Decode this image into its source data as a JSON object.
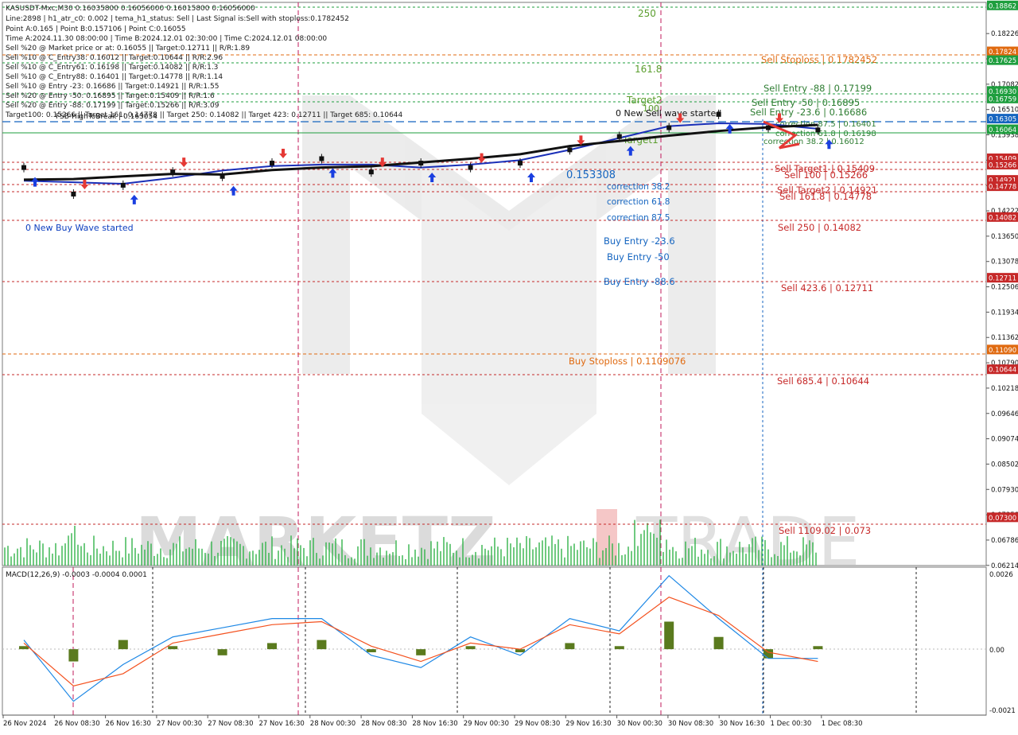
{
  "header": {
    "symbol_line": "KASUSDT-Mxc,M30  0.16035800 0.16056000 0.16015800 0.16056000",
    "info_lines": [
      "Line:2898 | h1_atr_c0: 0.002 | tema_h1_status: Sell | Last Signal is:Sell with stoploss:0.1782452",
      "Point A:0.165 | Point B:0.157106 | Point C:0.16055",
      "Time A:2024.11.30 08:00:00 | Time B:2024.12.01 02:30:00 | Time C:2024.12.01 08:00:00",
      "Sell %20 @ Market price or at: 0.16055 || Target:0.12711 || R/R:1.89",
      "Sell %10 @ C_Entry38: 0.16012 || Target:0.10644 || R/R:2.96",
      "Sell %10 @ C_Entry61: 0.16198 || Target:0.14082 || R/R:1.3",
      "Sell %10 @ C_Entry88: 0.16401 || Target:0.14778 || R/R:1.14",
      "Sell %10 @ Entry -23: 0.16686 || Target:0.14921 || R/R:1.55",
      "Sell %20 @ Entry -50: 0.16895 || Target:0.15409 || R/R:1.6",
      "Sell %20 @ Entry -88: 0.17199 || Target:0.15266 || R/R:3.09",
      "Target100: 0.15266 || Target 161: 0.14778 || Target 250: 0.14082 || Target 423: 0.12711 || Target 685: 0.10644"
    ]
  },
  "watermark": {
    "brand_left": "MARKETZ",
    "brand_right": "TRADE"
  },
  "price_axis": {
    "ticks": [
      "0.18226",
      "0.17654",
      "0.17082",
      "0.16510",
      "0.15938",
      "0.15366",
      "0.14794",
      "0.14222",
      "0.13650",
      "0.13078",
      "0.12506",
      "0.11934",
      "0.11362",
      "0.10790",
      "0.10218",
      "0.09646",
      "0.09074",
      "0.08502",
      "0.07930",
      "0.07358",
      "0.06786",
      "0.06214"
    ]
  },
  "price_tags": [
    {
      "text": "0.18862",
      "color": "#1e9e3e"
    },
    {
      "text": "0.17824",
      "color": "#e06a10"
    },
    {
      "text": "0.17625",
      "color": "#1e9e3e"
    },
    {
      "text": "0.16930",
      "color": "#1e9e3e"
    },
    {
      "text": "0.16759",
      "color": "#1e9e3e"
    },
    {
      "text": "0.16305",
      "color": "#1565c0"
    },
    {
      "text": "0.16064",
      "color": "#1e9e3e"
    },
    {
      "text": "0.15409",
      "color": "#c62828"
    },
    {
      "text": "0.15266",
      "color": "#c62828"
    },
    {
      "text": "0.14921",
      "color": "#c62828"
    },
    {
      "text": "0.14778",
      "color": "#c62828"
    },
    {
      "text": "0.14082",
      "color": "#c62828"
    },
    {
      "text": "0.12711",
      "color": "#c62828"
    },
    {
      "text": "0.11090",
      "color": "#e06a10"
    },
    {
      "text": "0.10644",
      "color": "#c62828"
    },
    {
      "text": "0.07300",
      "color": "#c62828"
    }
  ],
  "level_lines": [
    {
      "label": "Sell Stoploss | 0.1782452",
      "color": "#e06a10"
    },
    {
      "label": "Sell Entry -88 | 0.17199",
      "color": "#2e7d32"
    },
    {
      "label": "Sell Entry -50 | 0.16895",
      "color": "#2e7d32"
    },
    {
      "label": "Sell Entry -23.6 | 0.16686",
      "color": "#2e7d32"
    },
    {
      "label": "correction 87.5 | 0.16401",
      "color": "#2e7d32"
    },
    {
      "label": "correction 61.8 | 0.16198",
      "color": "#2e7d32"
    },
    {
      "label": "correction 38.2 | 0.16012",
      "color": "#2e7d32"
    },
    {
      "label": "Sell Target1 | 0.15409",
      "color": "#c62828"
    },
    {
      "label": "Sell 100 | 0.15266",
      "color": "#c62828"
    },
    {
      "label": "Sell Target2 | 0.14921",
      "color": "#c62828"
    },
    {
      "label": "Sell 161.8 | 0.14778",
      "color": "#c62828"
    },
    {
      "label": "Sell  250 | 0.14082",
      "color": "#c62828"
    },
    {
      "label": "Sell  423.6 | 0.12711",
      "color": "#c62828"
    },
    {
      "label": "Buy Stoploss | 0.1109076",
      "color": "#e06a10"
    },
    {
      "label": "Sell  685.4 | 0.10644",
      "color": "#c62828"
    },
    {
      "label": "Sell 1109.02 | 0.073",
      "color": "#c62828"
    }
  ],
  "annotations": {
    "fib_250": "250",
    "fib_161": "161.8",
    "fib_100": "100",
    "target2": "Target2",
    "target1": "Target1",
    "sell_wave": "0 New Sell wave started",
    "buy_wave": "0 New Buy Wave started",
    "fsb_break": "FSB-HighToBreak | 0.163054",
    "buy_levels": [
      "correction 38.2",
      "correction 61.8",
      "correction 87.5",
      "Buy Entry -23.6",
      "Buy Entry -50",
      "Buy Entry -88.6"
    ],
    "mid_price": "0.153308"
  },
  "macd": {
    "title": "MACD(12,26,9) -0.0003 -0.0004 0.0001",
    "ticks": [
      "0.0026",
      "0.00",
      "-0.0021"
    ]
  },
  "time_axis": {
    "labels": [
      "26 Nov 2024",
      "26 Nov 08:30",
      "26 Nov 16:30",
      "27 Nov 00:30",
      "27 Nov 08:30",
      "27 Nov 16:30",
      "28 Nov 00:30",
      "28 Nov 08:30",
      "28 Nov 16:30",
      "29 Nov 00:30",
      "29 Nov 08:30",
      "29 Nov 16:30",
      "30 Nov 00:30",
      "30 Nov 08:30",
      "30 Nov 16:30",
      "1 Dec 00:30",
      "1 Dec 08:30"
    ]
  },
  "chart_data": {
    "type": "scatter",
    "title": "KASUSDT-Mxc,M30",
    "x": [
      "26 Nov 2024",
      "26 Nov 08:30",
      "26 Nov 16:30",
      "27 Nov 00:30",
      "27 Nov 08:30",
      "27 Nov 16:30",
      "28 Nov 00:30",
      "28 Nov 08:30",
      "28 Nov 16:30",
      "29 Nov 00:30",
      "29 Nov 08:30",
      "29 Nov 16:30",
      "30 Nov 00:30",
      "30 Nov 08:30",
      "30 Nov 16:30",
      "1 Dec 00:30",
      "1 Dec 08:30"
    ],
    "ylim": [
      0.0621,
      0.1893
    ],
    "series": [
      {
        "values": [
          0.152,
          0.146,
          0.148,
          0.151,
          0.15,
          0.153,
          0.154,
          0.151,
          0.153,
          0.152,
          0.153,
          0.156,
          0.159,
          0.161,
          0.164,
          0.161,
          0.1605
        ]
      }
    ],
    "macd": {
      "ylim": [
        -0.0021,
        0.0026
      ],
      "histogram": [
        0.0001,
        -0.0004,
        0.0003,
        0.0001,
        -0.0002,
        0.0002,
        0.0003,
        -0.0001,
        -0.0002,
        0.0001,
        -0.0001,
        0.0002,
        0.0001,
        0.0009,
        0.0004,
        -0.0003,
        0.0001
      ],
      "macd_line": [
        0.0003,
        -0.0017,
        -0.0005,
        0.0004,
        0.0007,
        0.001,
        0.001,
        -0.0002,
        -0.0006,
        0.0004,
        -0.0002,
        0.001,
        0.0006,
        0.0024,
        0.001,
        -0.0003,
        -0.0003
      ],
      "signal_line": [
        0.0002,
        -0.0012,
        -0.0008,
        0.0002,
        0.0005,
        0.0008,
        0.0009,
        0.0001,
        -0.0004,
        0.0002,
        0.0,
        0.0008,
        0.0005,
        0.0017,
        0.0011,
        -0.0001,
        -0.0004
      ]
    }
  }
}
